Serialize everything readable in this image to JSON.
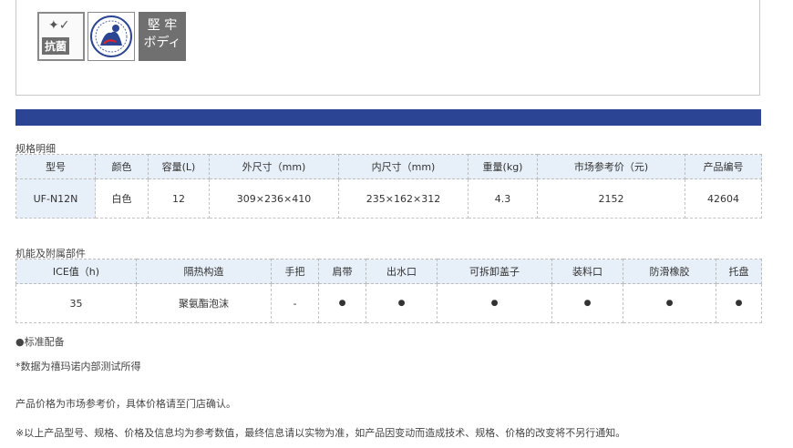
{
  "badges": {
    "antibacterial": {
      "label": "抗菌",
      "icon": "sparkle-check-icon"
    },
    "seal": {
      "icon": "bear-mark-seal-icon"
    },
    "sturdy": {
      "line1": "堅 牢",
      "line2": "ボディ"
    }
  },
  "accent_color": "#2b4594",
  "specs": {
    "title": "规格明细",
    "headers": [
      "型号",
      "颜色",
      "容量(L)",
      "外尺寸（mm)",
      "内尺寸（mm)",
      "重量(kg)",
      "市场参考价（元)",
      "产品编号"
    ],
    "row": [
      "UF-N12N",
      "白色",
      "12",
      "309×236×410",
      "235×162×312",
      "4.3",
      "2152",
      "42604"
    ]
  },
  "features": {
    "title": "机能及附属部件",
    "headers": [
      "ICE值（h)",
      "隔热构造",
      "手把",
      "肩带",
      "出水口",
      "可拆卸盖子",
      "装料口",
      "防滑橡胶",
      "托盘"
    ],
    "row": [
      "35",
      "聚氨酯泡沫",
      "-",
      "●",
      "●",
      "●",
      "●",
      "●",
      "●"
    ]
  },
  "notes": {
    "standard": "●标准配备",
    "data_source": "*数据为禧玛诺内部测试所得",
    "price_note": "产品价格为市场参考价，具体价格请至门店确认。",
    "disclaimer": "※以上产品型号、规格、价格及信息均为参考数值，最终信息请以实物为准，如产品因变动而造成技术、规格、价格的改变将不另行通知。"
  }
}
